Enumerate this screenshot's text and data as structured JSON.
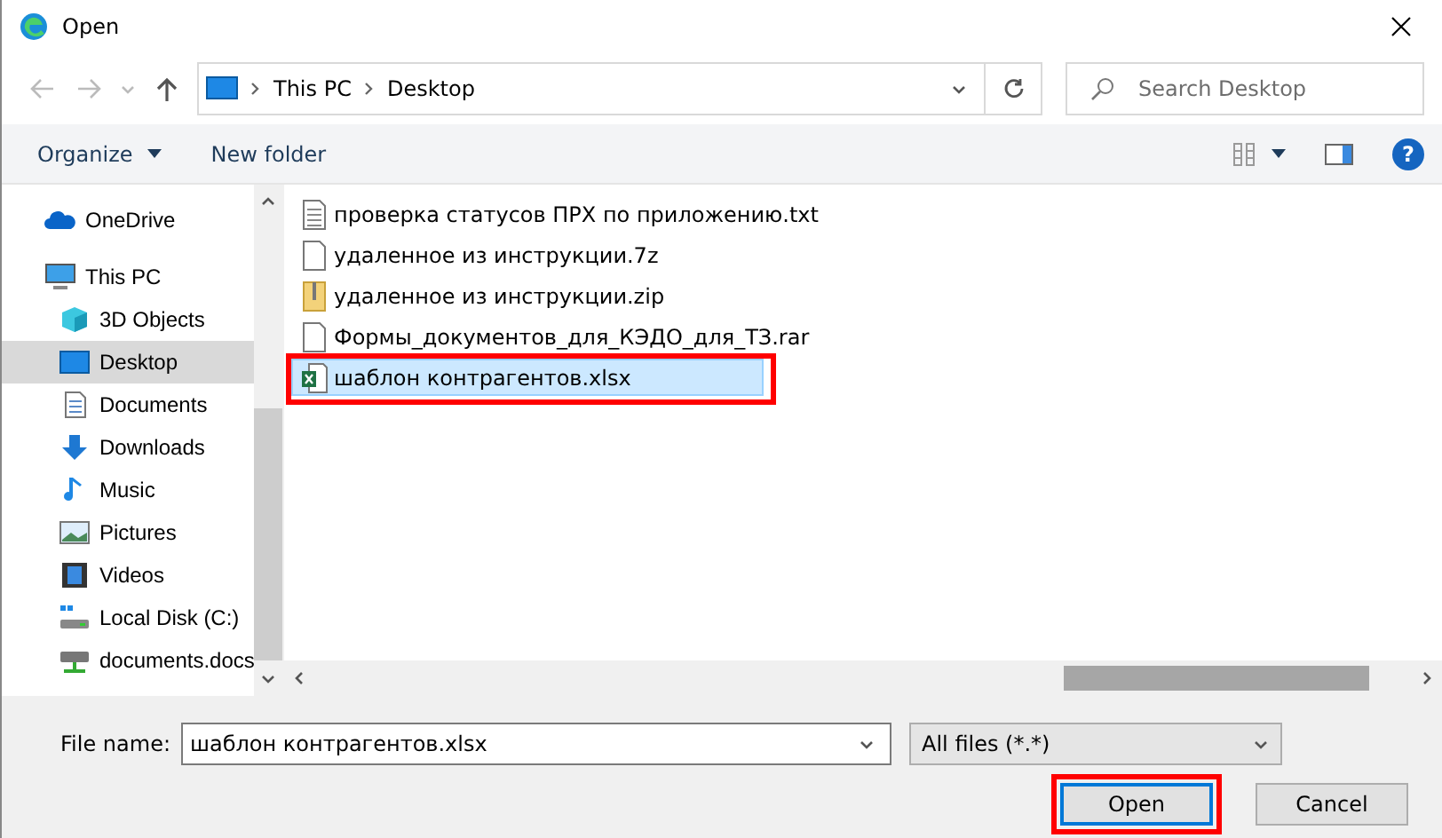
{
  "window": {
    "title": "Open"
  },
  "address": {
    "path": [
      "This PC",
      "Desktop"
    ]
  },
  "search": {
    "placeholder": "Search Desktop"
  },
  "toolbar": {
    "organize": "Organize",
    "new_folder": "New folder",
    "help": "?"
  },
  "sidebar": {
    "items": [
      {
        "label": "OneDrive",
        "kind": "cloud",
        "selected": false
      },
      {
        "label": "This PC",
        "kind": "pc",
        "selected": false,
        "children": [
          {
            "label": "3D Objects",
            "kind": "cube",
            "selected": false
          },
          {
            "label": "Desktop",
            "kind": "desktop",
            "selected": true
          },
          {
            "label": "Documents",
            "kind": "document",
            "selected": false
          },
          {
            "label": "Downloads",
            "kind": "download",
            "selected": false
          },
          {
            "label": "Music",
            "kind": "music",
            "selected": false
          },
          {
            "label": "Pictures",
            "kind": "pictures",
            "selected": false
          },
          {
            "label": "Videos",
            "kind": "videos",
            "selected": false
          },
          {
            "label": "Local Disk (C:)",
            "kind": "disk",
            "selected": false
          },
          {
            "label": "documents.docs",
            "kind": "network",
            "selected": false
          }
        ]
      }
    ]
  },
  "files": [
    {
      "name": "проверка статусов ПРХ по приложению.txt",
      "kind": "text",
      "selected": false,
      "highlighted": false
    },
    {
      "name": "удаленное из инструкции.7z",
      "kind": "blank",
      "selected": false,
      "highlighted": false
    },
    {
      "name": "удаленное из инструкции.zip",
      "kind": "zip",
      "selected": false,
      "highlighted": false
    },
    {
      "name": "Формы_документов_для_КЭДО_для_ТЗ.rar",
      "kind": "blank",
      "selected": false,
      "highlighted": false
    },
    {
      "name": "шаблон контрагентов.xlsx",
      "kind": "excel",
      "selected": true,
      "highlighted": true
    }
  ],
  "footer": {
    "file_name_label": "File name:",
    "file_name": "шаблон контрагентов.xlsx",
    "file_type": "All files (*.*)",
    "buttons": [
      {
        "label": "Open",
        "kind": "primary",
        "highlighted": true
      },
      {
        "label": "Cancel",
        "kind": "normal",
        "highlighted": false
      }
    ]
  }
}
